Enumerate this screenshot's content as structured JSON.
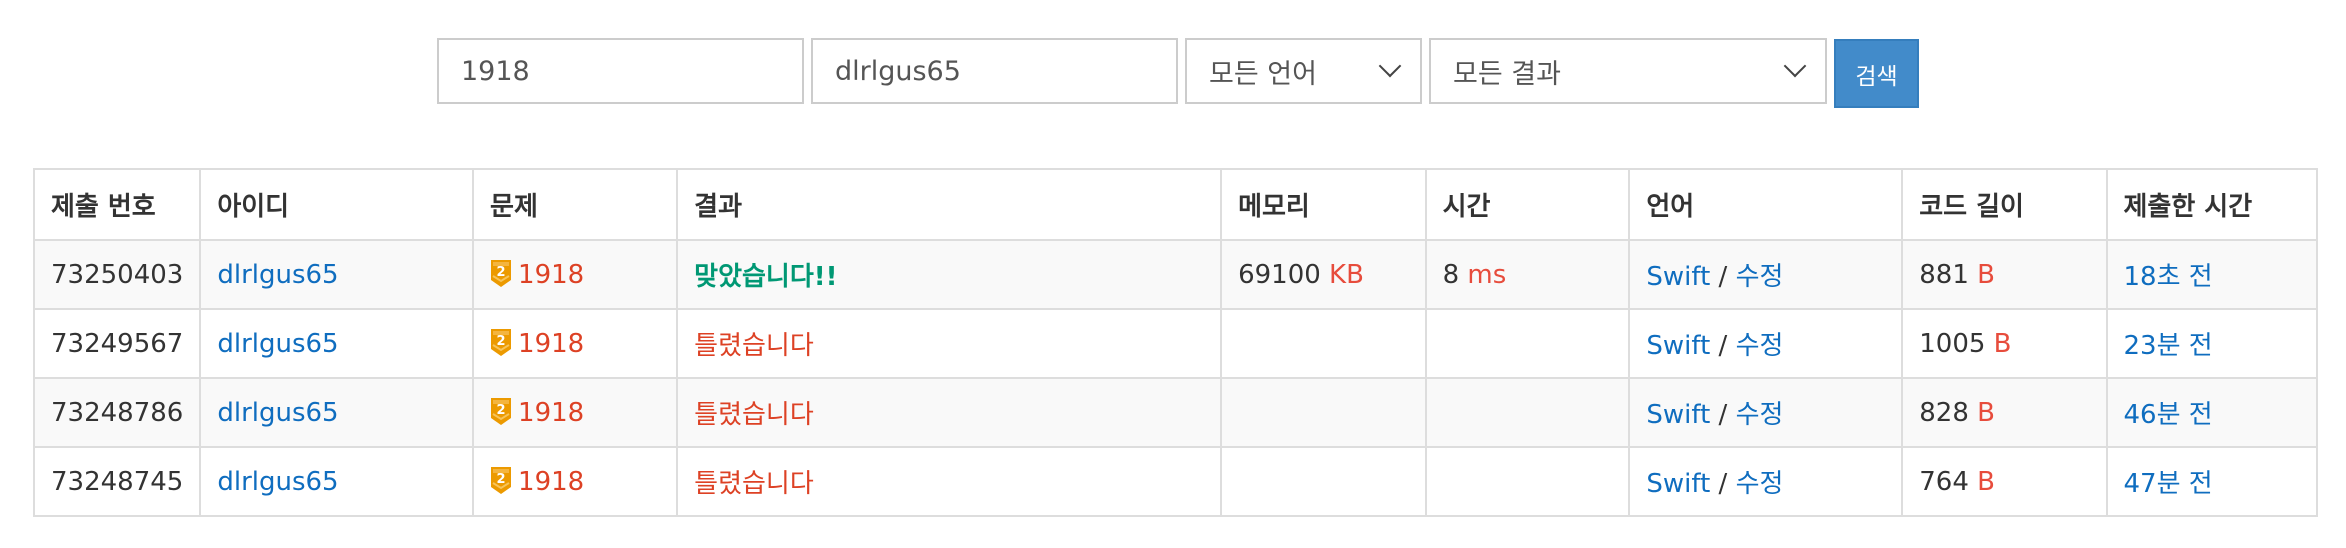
{
  "search": {
    "problem_id": "1918",
    "user_id": "dlrlgus65",
    "language": "모든 언어",
    "result": "모든 결과",
    "button": "검색"
  },
  "columns": [
    "제출 번호",
    "아이디",
    "문제",
    "결과",
    "메모리",
    "시간",
    "언어",
    "코드 길이",
    "제출한 시간"
  ],
  "rows": [
    {
      "id": "73250403",
      "user": "dlrlgus65",
      "tier": "2",
      "problem": "1918",
      "result": "맞았습니다!!",
      "result_type": "ok",
      "memory": "69100",
      "memory_unit": "KB",
      "time": "8",
      "time_unit": "ms",
      "lang": "Swift",
      "sep": "/",
      "edit": "수정",
      "code_len": "881",
      "code_unit": "B",
      "submitted": "18초 전"
    },
    {
      "id": "73249567",
      "user": "dlrlgus65",
      "tier": "2",
      "problem": "1918",
      "result": "틀렸습니다",
      "result_type": "wrong",
      "memory": "",
      "memory_unit": "",
      "time": "",
      "time_unit": "",
      "lang": "Swift",
      "sep": "/",
      "edit": "수정",
      "code_len": "1005",
      "code_unit": "B",
      "submitted": "23분 전"
    },
    {
      "id": "73248786",
      "user": "dlrlgus65",
      "tier": "2",
      "problem": "1918",
      "result": "틀렸습니다",
      "result_type": "wrong",
      "memory": "",
      "memory_unit": "",
      "time": "",
      "time_unit": "",
      "lang": "Swift",
      "sep": "/",
      "edit": "수정",
      "code_len": "828",
      "code_unit": "B",
      "submitted": "46분 전"
    },
    {
      "id": "73248745",
      "user": "dlrlgus65",
      "tier": "2",
      "problem": "1918",
      "result": "틀렸습니다",
      "result_type": "wrong",
      "memory": "",
      "memory_unit": "",
      "time": "",
      "time_unit": "",
      "lang": "Swift",
      "sep": "/",
      "edit": "수정",
      "code_len": "764",
      "code_unit": "B",
      "submitted": "47분 전"
    }
  ],
  "colors": {
    "link": "#0f6dbf",
    "accepted": "#009874",
    "wrong": "#dd4124",
    "tier_gold": "#ec9a00",
    "button": "#428bca"
  }
}
